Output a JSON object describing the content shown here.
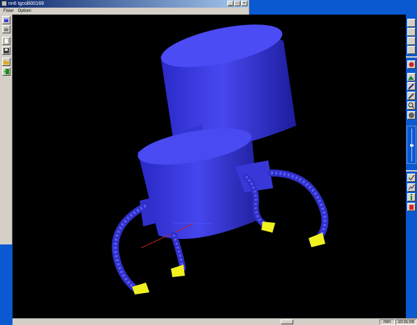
{
  "window": {
    "title": "nn6 tgcolli00169"
  },
  "menu": {
    "items": [
      "Fisier",
      "Optiuni"
    ]
  },
  "left_toolbar": {
    "buttons": [
      "cube-icon",
      "cube-grey-icon",
      "new-file-icon",
      "save-icon",
      "open-folder-icon",
      "exit-icon"
    ]
  },
  "right_toolbar": {
    "buttons": [
      "view-icon-1",
      "view-icon-2",
      "view-icon-3",
      "view-icon-4",
      "shading-icon",
      "image-icon",
      "pen-icon",
      "pencil-icon",
      "zoom-icon",
      "sphere-icon",
      "check-icon",
      "graph-icon",
      "info-icon",
      "hand-icon"
    ]
  },
  "status": {
    "units": "mm",
    "time": "10:31:08"
  },
  "colors": {
    "object": "#3a3ad9",
    "tips": "#f0f020",
    "desktop": "#0a59d1"
  }
}
